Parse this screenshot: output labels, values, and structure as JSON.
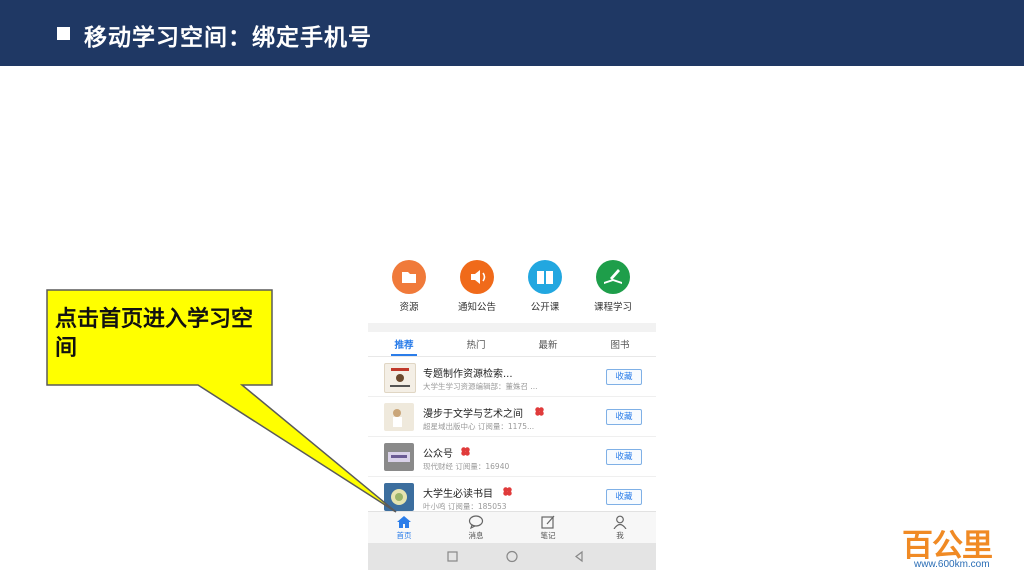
{
  "slide": {
    "title": "移动学习空间：绑定手机号"
  },
  "callout": {
    "text": "点击首页进入学习空间",
    "color": "#ffff00"
  },
  "quick_access": [
    {
      "label": "资源",
      "icon": "folder-icon",
      "color": "#f07a3a"
    },
    {
      "label": "通知公告",
      "icon": "speaker-icon",
      "color": "#f06a1a"
    },
    {
      "label": "公开课",
      "icon": "book-icon",
      "color": "#22a7e0"
    },
    {
      "label": "课程学习",
      "icon": "open-book-icon",
      "color": "#1e9e4a"
    }
  ],
  "tabs": [
    "推荐",
    "热门",
    "最新",
    "图书"
  ],
  "active_tab": "推荐",
  "list": [
    {
      "title": "专题制作资源检索...",
      "subtitle": "大学生学习资源编辑部：董姝召 ...",
      "button": "收藏"
    },
    {
      "title": "漫步于文学与艺术之间",
      "subtitle": "超星域出版中心    订阅量：1175...",
      "button": "收藏"
    },
    {
      "title": "公众号",
      "subtitle": "现代财经    订阅量：16940",
      "button": "收藏"
    },
    {
      "title": "大学生必读书目",
      "subtitle": "叶小鸣    订阅量：185053",
      "button": "收藏"
    }
  ],
  "bottom_nav": [
    {
      "label": "首页",
      "icon": "home-icon",
      "active": true
    },
    {
      "label": "消息",
      "icon": "chat-icon",
      "active": false
    },
    {
      "label": "笔记",
      "icon": "edit-icon",
      "active": false
    },
    {
      "label": "我",
      "icon": "person-icon",
      "active": false
    }
  ],
  "logo": {
    "name": "百公里",
    "url": "www.600km.com",
    "color": "#f08a24"
  },
  "colors": {
    "header_bg": "#1f3864",
    "accent": "#2b7de9"
  }
}
